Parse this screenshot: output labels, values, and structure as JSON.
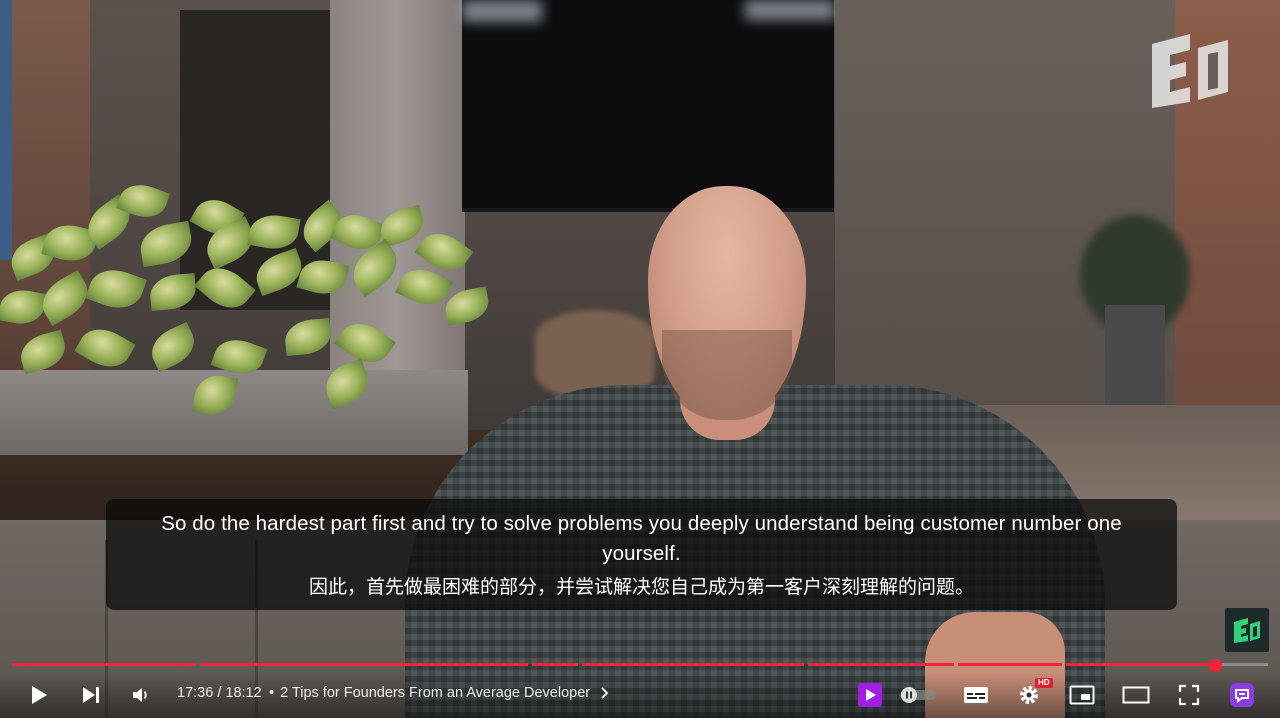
{
  "video": {
    "caption_en": "So do the hardest part first and try to solve problems you deeply understand being customer number one yourself.",
    "caption_zh": "因此，首先做最困难的部分，并尝试解决您自己成为第一客户深刻理解的问题。",
    "progress_fraction": 0.958
  },
  "controls": {
    "current_time": "17:36",
    "duration": "18:12",
    "time_separator": "/",
    "chapter_bullet": "•",
    "chapter_title": "2 Tips for Founders From an Average Developer",
    "hd_badge": "HD"
  },
  "icons": {
    "play": "play-icon",
    "next": "next-icon",
    "volume": "volume-icon",
    "chevron": "chevron-right-icon",
    "premium": "premium-play-icon",
    "autoplay": "autoplay-toggle",
    "subtitles": "subtitles-icon",
    "settings": "gear-icon",
    "miniplayer": "miniplayer-icon",
    "theater": "theater-mode-icon",
    "fullscreen": "fullscreen-icon",
    "extension": "extension-icon"
  },
  "colors": {
    "progress_played": "#f2233b",
    "premium_accent": "#a21ee5",
    "extension_accent": "#8b3be8",
    "caption_bg": "rgba(8,8,8,0.72)"
  }
}
